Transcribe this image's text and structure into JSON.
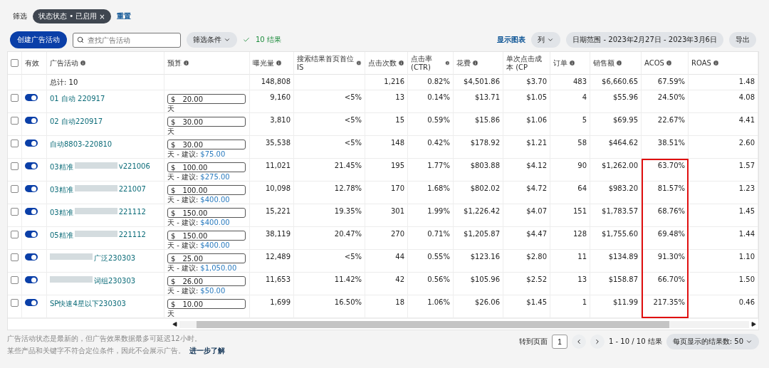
{
  "filter_bar": {
    "label": "筛选",
    "chips": [
      {
        "label": "状态状态 • 已启用",
        "close": "×"
      }
    ],
    "reset": "重置"
  },
  "toolbar": {
    "create_button": "创建广告活动",
    "search": {
      "placeholder": "查找广告活动"
    },
    "filter_dropdown": "筛选条件",
    "result_note": "10 结果",
    "show_chart": "显示图表",
    "columns_button": "列",
    "date_range": "日期范围 - 2023年2月27日 - 2023年3月6日",
    "export": "导出"
  },
  "table": {
    "select_all_checked": false,
    "columns": [
      {
        "label": "有效",
        "info": false
      },
      {
        "label": "广告活动",
        "info": true
      },
      {
        "label": "预算",
        "info": true
      },
      {
        "label": "曝光量",
        "info": true
      },
      {
        "label": "搜索结果首页首位 IS",
        "info": true
      },
      {
        "label": "点击次数",
        "info": true
      },
      {
        "label": "点击率 (CTR)",
        "info": true
      },
      {
        "label": "花费",
        "info": true
      },
      {
        "label": "单次点击成本 (CP",
        "info": false
      },
      {
        "label": "订单",
        "info": true
      },
      {
        "label": "销售额",
        "info": true
      },
      {
        "label": "ACOS",
        "info": true
      },
      {
        "label": "ROAS",
        "info": true
      }
    ],
    "total": {
      "label": "总计: 10",
      "impressions": "148,808",
      "clicks": "1,216",
      "ctr": "0.82%",
      "spend": "$4,501.86",
      "cpc": "$3.70",
      "orders": "483",
      "sales": "$6,660.65",
      "acos": "67.59%",
      "roas": "1.48"
    },
    "rows": [
      {
        "checked": false,
        "on": true,
        "name_prefix": "01 自动 220917",
        "redacted": false,
        "budget": "20.00",
        "currency": "$",
        "budget_unit": "天",
        "impressions": "9,160",
        "top_is": "<5%",
        "clicks": "13",
        "ctr": "0.14%",
        "spend": "$13.71",
        "cpc": "$1.05",
        "orders": "4",
        "sales": "$55.96",
        "acos": "24.50%",
        "roas": "4.08",
        "flagged": false
      },
      {
        "checked": false,
        "on": true,
        "name_prefix": "02 自动220917",
        "redacted": false,
        "budget": "30.00",
        "currency": "$",
        "budget_unit": "天",
        "impressions": "3,810",
        "top_is": "<5%",
        "clicks": "15",
        "ctr": "0.59%",
        "spend": "$15.86",
        "cpc": "$1.06",
        "orders": "5",
        "sales": "$69.95",
        "acos": "22.67%",
        "roas": "4.41",
        "flagged": false
      },
      {
        "checked": false,
        "on": true,
        "name_prefix": "自动8803-220810",
        "redacted": false,
        "budget": "30.00",
        "currency": "$",
        "budget_unit": "天 - 建议:",
        "suggestion": "$75.00",
        "impressions": "35,538",
        "top_is": "<5%",
        "clicks": "148",
        "ctr": "0.42%",
        "spend": "$178.92",
        "cpc": "$1.21",
        "orders": "58",
        "sales": "$464.62",
        "acos": "38.51%",
        "roas": "2.60",
        "flagged": false
      },
      {
        "checked": false,
        "on": true,
        "name_prefix": "03精准",
        "redacted": true,
        "name_suffix": "v221006",
        "budget": "100.00",
        "currency": "$",
        "budget_unit": "天 - 建议:",
        "suggestion": "$275.00",
        "impressions": "11,021",
        "top_is": "21.45%",
        "clicks": "195",
        "ctr": "1.77%",
        "spend": "$803.88",
        "cpc": "$4.12",
        "orders": "90",
        "sales": "$1,262.00",
        "acos": "63.70%",
        "roas": "1.57",
        "flagged": true
      },
      {
        "checked": false,
        "on": true,
        "name_prefix": "03精准",
        "redacted": true,
        "name_suffix": "221007",
        "budget": "100.00",
        "currency": "$",
        "budget_unit": "天 - 建议:",
        "suggestion": "$400.00",
        "impressions": "10,098",
        "top_is": "12.78%",
        "clicks": "170",
        "ctr": "1.68%",
        "spend": "$802.02",
        "cpc": "$4.72",
        "orders": "64",
        "sales": "$983.20",
        "acos": "81.57%",
        "roas": "1.23",
        "flagged": true
      },
      {
        "checked": false,
        "on": true,
        "name_prefix": "03精准",
        "redacted": true,
        "name_suffix": "221112",
        "budget": "150.00",
        "currency": "$",
        "budget_unit": "天 - 建议:",
        "suggestion": "$400.00",
        "impressions": "15,221",
        "top_is": "19.35%",
        "clicks": "301",
        "ctr": "1.99%",
        "spend": "$1,226.42",
        "cpc": "$4.07",
        "orders": "151",
        "sales": "$1,783.57",
        "acos": "68.76%",
        "roas": "1.45",
        "flagged": true
      },
      {
        "checked": false,
        "on": true,
        "name_prefix": "05精准",
        "redacted": true,
        "name_suffix": "221112",
        "budget": "150.00",
        "currency": "$",
        "budget_unit": "天 - 建议:",
        "suggestion": "$400.00",
        "impressions": "38,119",
        "top_is": "20.47%",
        "clicks": "270",
        "ctr": "0.71%",
        "spend": "$1,205.87",
        "cpc": "$4.47",
        "orders": "128",
        "sales": "$1,755.60",
        "acos": "69.48%",
        "roas": "1.44",
        "flagged": true
      },
      {
        "checked": false,
        "on": true,
        "redacted": true,
        "name_suffix": "广泛230303",
        "budget": "25.00",
        "currency": "$",
        "budget_unit": "天 - 建议:",
        "suggestion": "$1,050.00",
        "impressions": "12,489",
        "top_is": "<5%",
        "clicks": "44",
        "ctr": "0.55%",
        "spend": "$123.16",
        "cpc": "$2.80",
        "orders": "11",
        "sales": "$134.89",
        "acos": "91.30%",
        "roas": "1.10",
        "flagged": true
      },
      {
        "checked": false,
        "on": true,
        "redacted": true,
        "name_suffix": "词组230303",
        "budget": "26.00",
        "currency": "$",
        "budget_unit": "天 - 建议:",
        "suggestion": "$50.00",
        "impressions": "11,653",
        "top_is": "11.42%",
        "clicks": "42",
        "ctr": "0.56%",
        "spend": "$105.96",
        "cpc": "$2.52",
        "orders": "13",
        "sales": "$158.87",
        "acos": "66.70%",
        "roas": "1.50",
        "flagged": true
      },
      {
        "checked": false,
        "on": true,
        "name_prefix": "SP快速4星以下230303",
        "redacted": false,
        "budget": "10.00",
        "currency": "$",
        "budget_unit": "天",
        "impressions": "1,699",
        "top_is": "16.50%",
        "clicks": "18",
        "ctr": "1.06%",
        "spend": "$26.06",
        "cpc": "$1.45",
        "orders": "1",
        "sales": "$11.99",
        "acos": "217.35%",
        "roas": "0.46",
        "flagged": true
      }
    ]
  },
  "footer": {
    "notes": [
      "广告活动状态是最新的，但广告效果数据最多可延迟12小时。",
      "某些产品和关键字不符合定位条件，因此不会展示广告。"
    ],
    "learn_more": "进一步了解",
    "goto_label": "转到页面",
    "page": "1",
    "range": "1 - 10 / 10 结果",
    "per_page_label": "每页显示的结果数:",
    "per_page": "50"
  }
}
